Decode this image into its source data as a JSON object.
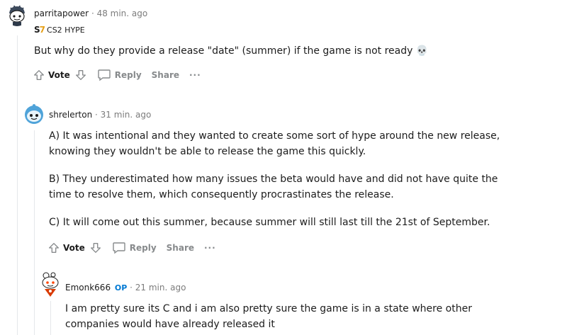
{
  "comments": [
    {
      "username": "parritapower",
      "time": "· 48 min. ago",
      "flair": "CS2 HYPE",
      "body": [
        "But why do they provide a release \"date\" (summer) if the game is not ready 💀"
      ],
      "actions": {
        "vote": "Vote",
        "reply": "Reply",
        "share": "Share",
        "more": "···"
      }
    },
    {
      "username": "shrelerton",
      "time": "· 31 min. ago",
      "body": [
        "A) It was intentional and they wanted to create some sort of hype around the new release,",
        "knowing they wouldn't be able to release the game this quickly.",
        "B) They underestimated how many issues the beta would have and did not have quite the",
        "time to resolve them, which consequently procrastinates the release.",
        "C) It will come out this summer, because summer will still last till the 21st of September."
      ],
      "actions": {
        "vote": "Vote",
        "reply": "Reply",
        "share": "Share",
        "more": "···"
      }
    },
    {
      "username": "Emonk666",
      "op": "OP",
      "time": "· 21 min. ago",
      "body": [
        "I am pretty sure its C and i am also pretty sure the game is in a state where other",
        "companies would have already released it"
      ]
    }
  ]
}
